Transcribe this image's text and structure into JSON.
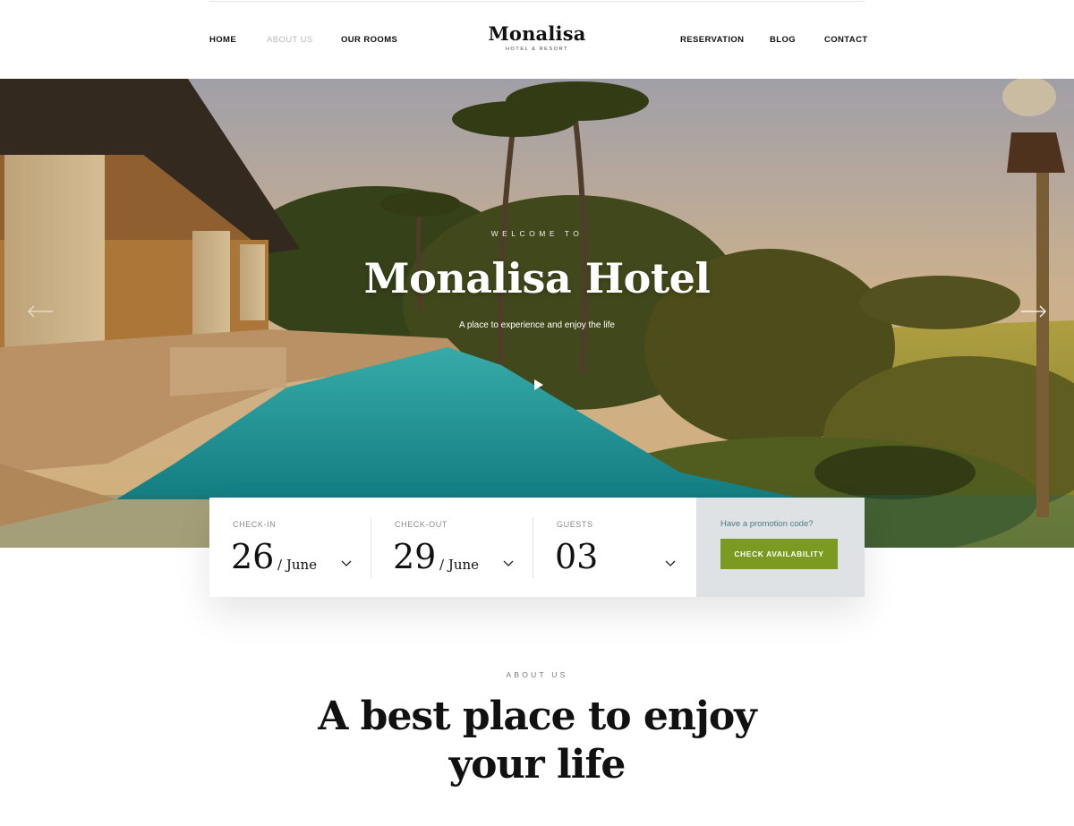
{
  "header": {
    "nav_left": [
      "HOME",
      "ABOUT US",
      "OUR ROOMS"
    ],
    "nav_right": [
      "RESERVATION",
      "BLOG",
      "CONTACT"
    ],
    "logo_name": "Monalisa",
    "logo_tagline": "HOTEL & RESORT"
  },
  "hero": {
    "eyebrow": "WELCOME TO",
    "title": "Monalisa Hotel",
    "subtitle": "A place to experience and enjoy the life",
    "icons": [
      "arrow-left-icon",
      "arrow-right-icon",
      "play-icon"
    ]
  },
  "booking": {
    "checkin_label": "CHECK-IN",
    "checkin_day": "26",
    "checkin_month": "/ June",
    "checkout_label": "CHECK-OUT",
    "checkout_day": "29",
    "checkout_month": "/ June",
    "guests_label": "GUESTS",
    "guests_value": "03",
    "promo_link": "Have a promotion code?",
    "check_button": "CHECK AVAILABILITY",
    "button_color": "#7b9a22"
  },
  "about": {
    "eyebrow": "ABOUT US",
    "title": "A best place to enjoy your life"
  }
}
